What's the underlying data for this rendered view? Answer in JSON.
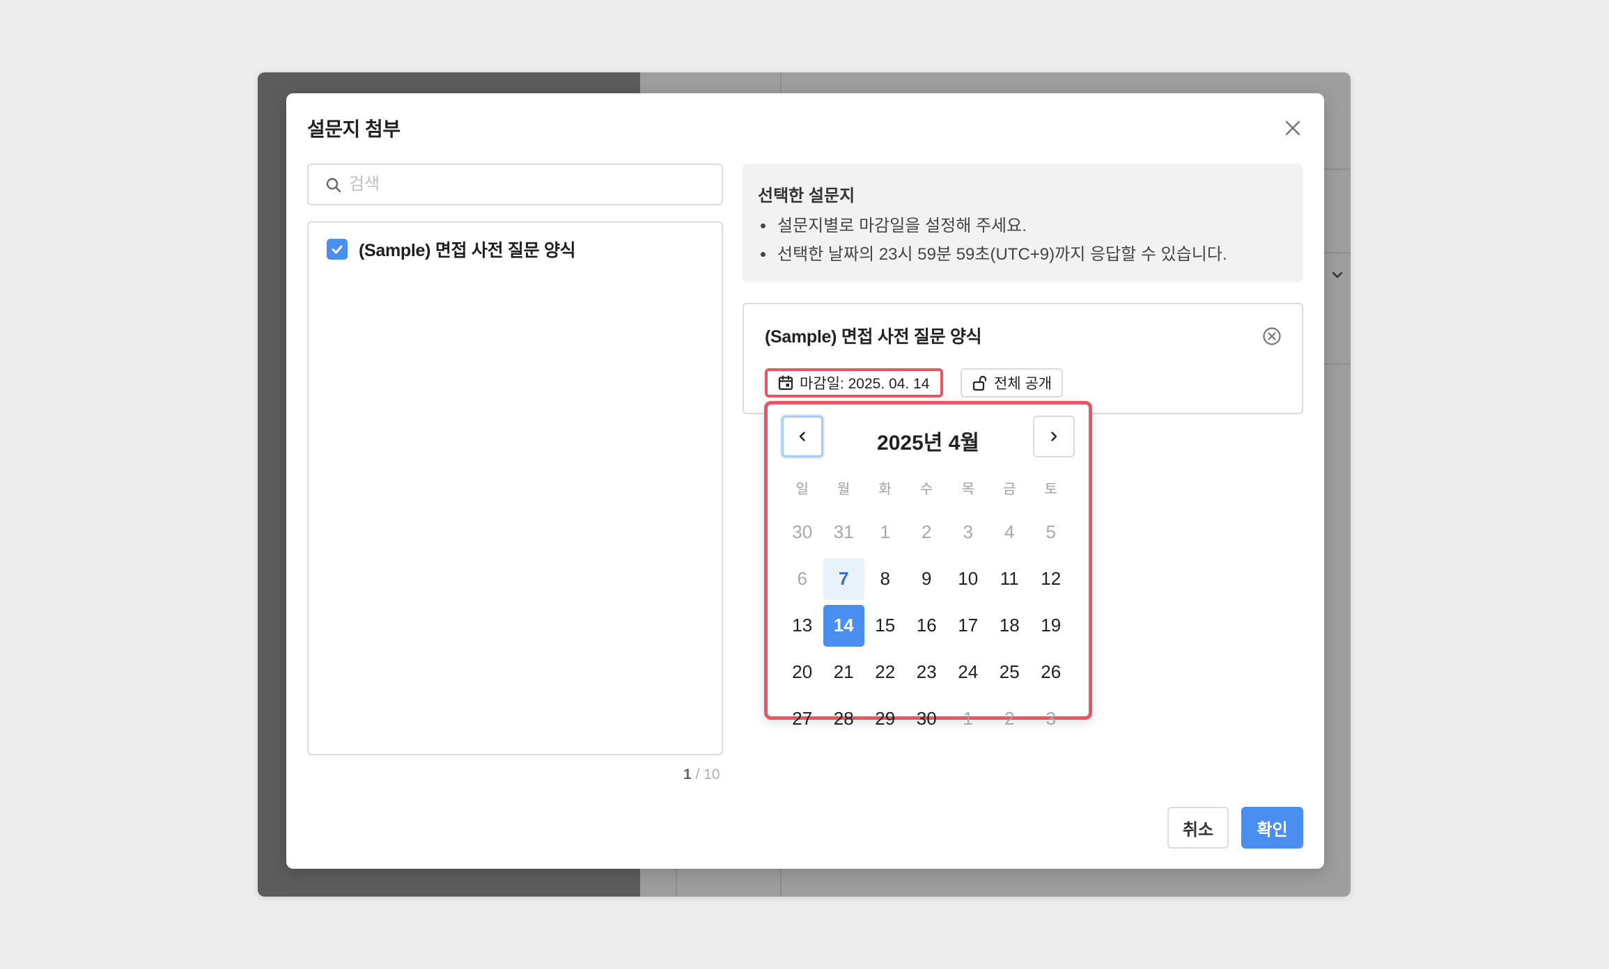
{
  "modal": {
    "title": "설문지 첨부",
    "close_icon": "close-icon"
  },
  "search": {
    "placeholder": "검색",
    "value": ""
  },
  "survey_list": {
    "items": [
      {
        "label": "(Sample) 면접 사전 질문 양식",
        "checked": true
      }
    ],
    "pager": {
      "current": "1",
      "total": "10",
      "separator": "/"
    }
  },
  "info": {
    "title": "선택한 설문지",
    "bullets": [
      "설문지별로 마감일을 설정해 주세요.",
      "선택한 날짜의 23시 59분 59초(UTC+9)까지 응답할 수 있습니다."
    ]
  },
  "selected_survey": {
    "title": "(Sample) 면접 사전 질문 양식",
    "deadline_label": "마감일: 2025. 04. 14",
    "visibility_label": "전체 공개"
  },
  "calendar": {
    "title": "2025년 4월",
    "weekdays": [
      "일",
      "월",
      "화",
      "수",
      "목",
      "금",
      "토"
    ],
    "weeks": [
      [
        {
          "d": "30",
          "m": true
        },
        {
          "d": "31",
          "m": true
        },
        {
          "d": "1",
          "m": true
        },
        {
          "d": "2",
          "m": true
        },
        {
          "d": "3",
          "m": true
        },
        {
          "d": "4",
          "m": true
        },
        {
          "d": "5",
          "m": true
        }
      ],
      [
        {
          "d": "6",
          "m": true
        },
        {
          "d": "7",
          "t": true
        },
        {
          "d": "8"
        },
        {
          "d": "9"
        },
        {
          "d": "10"
        },
        {
          "d": "11"
        },
        {
          "d": "12"
        }
      ],
      [
        {
          "d": "13"
        },
        {
          "d": "14",
          "s": true
        },
        {
          "d": "15"
        },
        {
          "d": "16"
        },
        {
          "d": "17"
        },
        {
          "d": "18"
        },
        {
          "d": "19"
        }
      ],
      [
        {
          "d": "20"
        },
        {
          "d": "21"
        },
        {
          "d": "22"
        },
        {
          "d": "23"
        },
        {
          "d": "24"
        },
        {
          "d": "25"
        },
        {
          "d": "26"
        }
      ],
      [
        {
          "d": "27"
        },
        {
          "d": "28"
        },
        {
          "d": "29"
        },
        {
          "d": "30"
        },
        {
          "d": "1",
          "m": true
        },
        {
          "d": "2",
          "m": true
        },
        {
          "d": "3",
          "m": true
        }
      ]
    ]
  },
  "footer": {
    "cancel_label": "취소",
    "confirm_label": "확인"
  },
  "colors": {
    "accent": "#4a8ff0",
    "highlight_border": "#e85563",
    "today_bg": "#e9f1fd"
  }
}
